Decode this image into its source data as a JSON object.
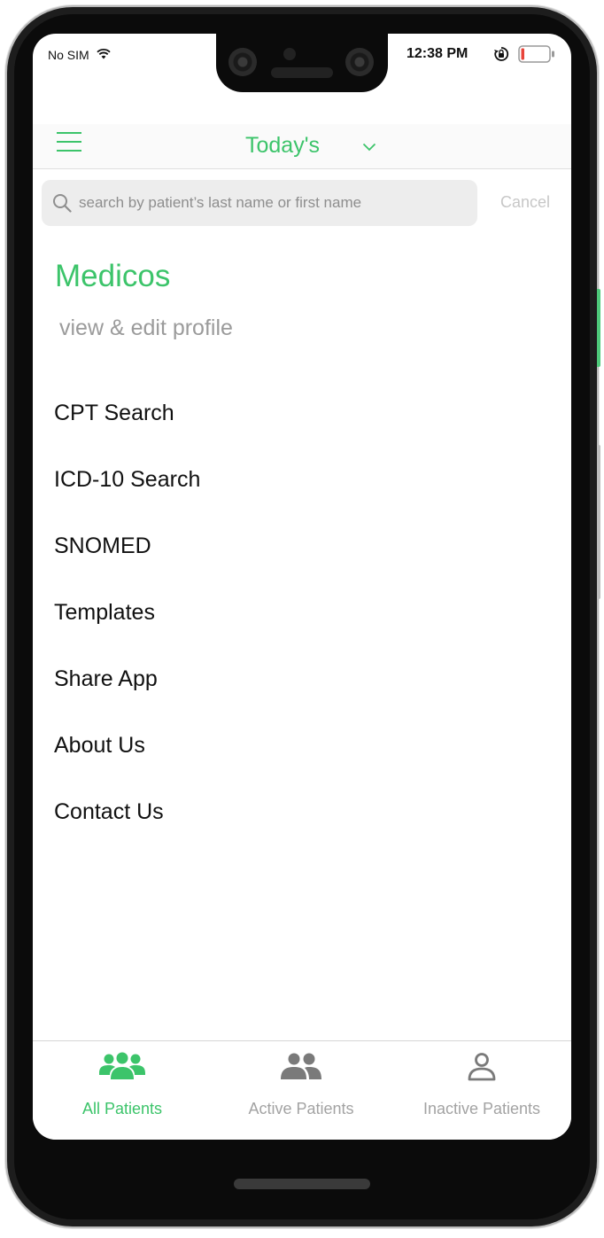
{
  "status_bar": {
    "carrier": "No SIM",
    "time": "12:38 PM",
    "battery_color": "#e8443a"
  },
  "header": {
    "filter_label": "Today's"
  },
  "search": {
    "placeholder": "search by patient’s last name or first name",
    "value": "",
    "cancel_label": "Cancel"
  },
  "profile": {
    "name": "Medicos",
    "edit_label": "view & edit profile"
  },
  "menu": {
    "items": [
      {
        "label": "CPT Search"
      },
      {
        "label": "ICD-10 Search"
      },
      {
        "label": "SNOMED"
      },
      {
        "label": "Templates"
      },
      {
        "label": "Share App"
      },
      {
        "label": "About Us"
      },
      {
        "label": "Contact Us"
      }
    ]
  },
  "tab_bar": {
    "tabs": [
      {
        "label": "All Patients",
        "icon": "group-three-people-icon",
        "active": true
      },
      {
        "label": "Active Patients",
        "icon": "group-two-people-icon",
        "active": false
      },
      {
        "label": "Inactive Patients",
        "icon": "single-person-icon",
        "active": false
      }
    ]
  },
  "colors": {
    "accent": "#3cc46a",
    "inactive_tab": "#a3a3a3",
    "text": "#111111"
  }
}
